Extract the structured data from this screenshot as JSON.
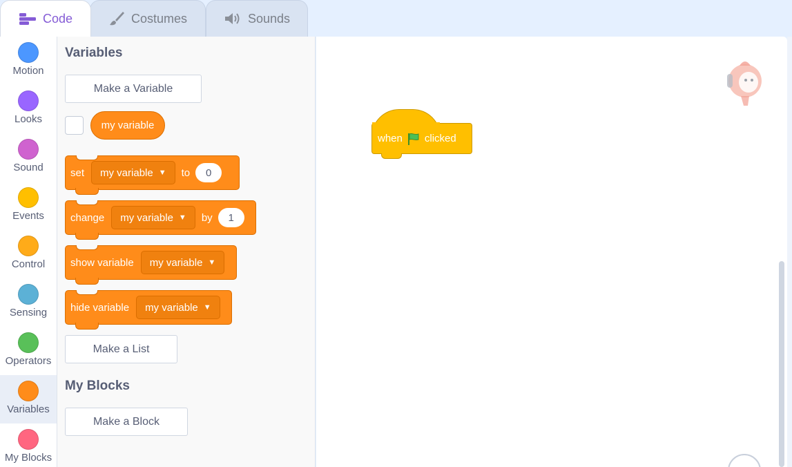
{
  "tabs": [
    {
      "label": "Code",
      "icon": "code-icon"
    },
    {
      "label": "Costumes",
      "icon": "brush-icon"
    },
    {
      "label": "Sounds",
      "icon": "speaker-icon"
    }
  ],
  "categories": [
    {
      "label": "Motion",
      "color": "#4c97ff"
    },
    {
      "label": "Looks",
      "color": "#9966ff"
    },
    {
      "label": "Sound",
      "color": "#cf63cf"
    },
    {
      "label": "Events",
      "color": "#ffbf00"
    },
    {
      "label": "Control",
      "color": "#ffab19"
    },
    {
      "label": "Sensing",
      "color": "#5cb1d6"
    },
    {
      "label": "Operators",
      "color": "#59c059"
    },
    {
      "label": "Variables",
      "color": "#ff8c1a"
    },
    {
      "label": "My Blocks",
      "color": "#ff6680"
    }
  ],
  "palette": {
    "variables_title": "Variables",
    "make_variable": "Make a Variable",
    "reporter": "my variable",
    "set_block": {
      "kw": "set",
      "var": "my variable",
      "to": "to",
      "value": "0"
    },
    "change_block": {
      "kw": "change",
      "var": "my variable",
      "by": "by",
      "value": "1"
    },
    "show_block": {
      "kw": "show variable",
      "var": "my variable"
    },
    "hide_block": {
      "kw": "hide variable",
      "var": "my variable"
    },
    "make_list": "Make a List",
    "myblocks_title": "My Blocks",
    "make_block": "Make a Block"
  },
  "script": {
    "hat_when": "when",
    "hat_clicked": "clicked"
  },
  "colors": {
    "variables": "#ff8c1a",
    "events": "#ffbf00",
    "accent": "#855cd6"
  }
}
